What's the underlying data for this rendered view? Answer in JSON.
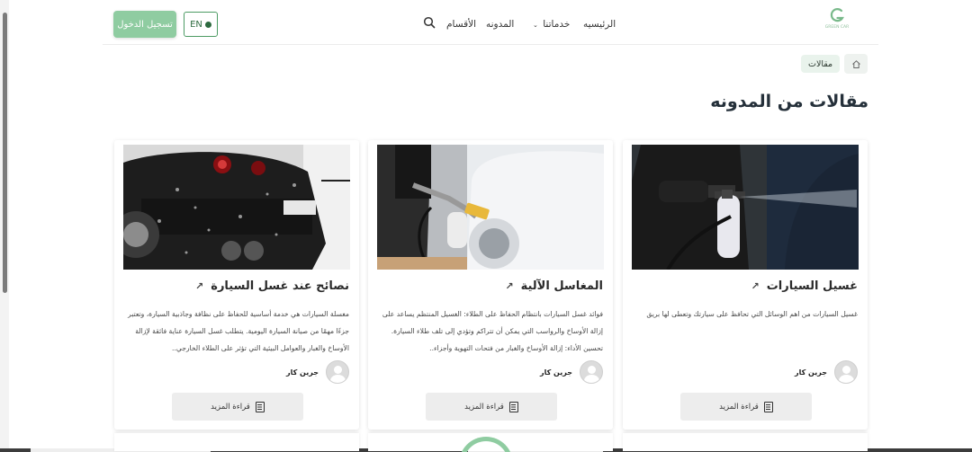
{
  "header": {
    "login_label": "تسجيل الدخول",
    "lang_label": "EN",
    "nav": {
      "home": "الرئيسيه",
      "services": "خدماتنا",
      "blog": "المدونه",
      "categories": "الأقسام"
    },
    "logo_text": "GREEN CAR"
  },
  "breadcrumb": {
    "current": "مقالات"
  },
  "page_title": "مقالات من المدونه",
  "cards": [
    {
      "title": "غسيل السيارات",
      "excerpt": "غسيل السيارات من اهم الوسائل التي تحافظ على سيارتك وتعطى لها بريق",
      "author": "جرين كار",
      "read_more": "قراءة المزيد"
    },
    {
      "title": "المغاسل الآلية",
      "excerpt": "فوائد غسل السيارات بانتظام الحفاظ على الطلاء: الغسيل المنتظم يساعد على إزالة الأوساخ والرواسب التي يمكن أن تتراكم وتؤدي إلى تلف طلاء السيارة. تحسين الأداء: إزالة الأوساخ والغبار من فتحات التهوية وأجزاء..",
      "author": "جرين كار",
      "read_more": "قراءة المزيد"
    },
    {
      "title": "نصائح عند غسل السيارة",
      "excerpt": "مغسلة السيارات هي خدمة أساسية للحفاظ على نظافة وجاذبية السيارة، وتعتبر جزءًا مهمًا من صيانة السيارة اليومية. يتطلب غسل السيارة عناية فائقة لإزالة الأوساخ والغبار والعوامل البيئية التي تؤثر على الطلاء الخارجي..",
      "author": "جرين كار",
      "read_more": "قراءة المزيد"
    }
  ],
  "colors": {
    "brand_green": "#8fcca1",
    "dark_green": "#2d6a3f",
    "title_dark": "#25303a"
  }
}
